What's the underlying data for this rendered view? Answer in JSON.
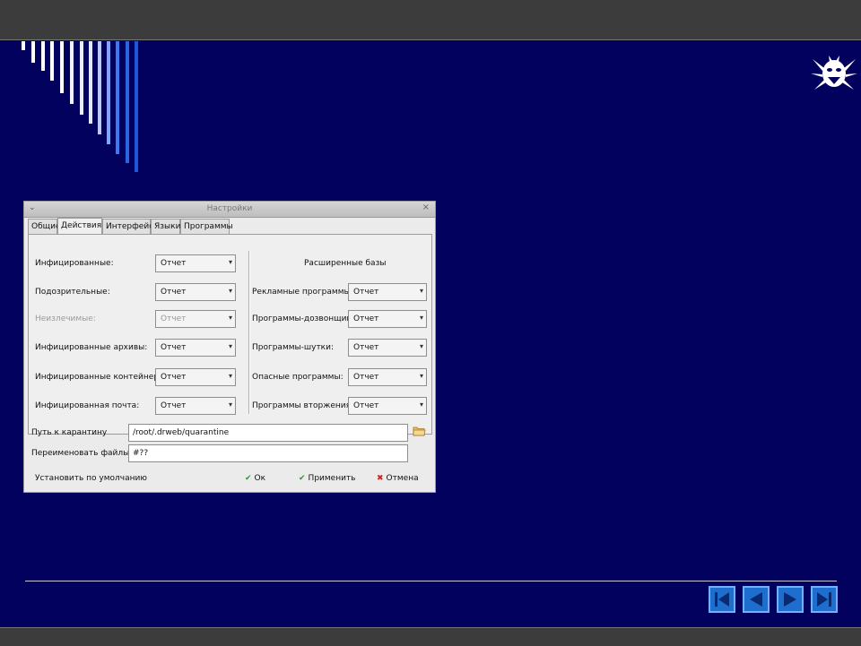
{
  "dialog": {
    "title": "Настройки",
    "menu_glyph": "⌄",
    "close_glyph": "×",
    "tabs": [
      {
        "label": "Общие"
      },
      {
        "label": "Действия"
      },
      {
        "label": "Интерфейс"
      },
      {
        "label": "Языки"
      },
      {
        "label": "Программы"
      }
    ],
    "active_tab": "Действия",
    "left_rows": [
      {
        "label": "Инфицированные:",
        "value": "Отчет",
        "disabled": false
      },
      {
        "label": "Подозрительные:",
        "value": "Отчет",
        "disabled": false
      },
      {
        "label": "Неизлечимые:",
        "value": "Отчет",
        "disabled": true
      },
      {
        "label": "Инфицированные архивы:",
        "value": "Отчет",
        "disabled": false
      },
      {
        "label": "Инфицированные контейнеры:",
        "value": "Отчет",
        "disabled": false
      },
      {
        "label": "Инфицированная почта:",
        "value": "Отчет",
        "disabled": false
      }
    ],
    "right_header": "Расширенные базы",
    "right_rows": [
      {
        "label": "Рекламные программы:",
        "value": "Отчет"
      },
      {
        "label": "Программы-дозвонщики:",
        "value": "Отчет"
      },
      {
        "label": "Программы-шутки:",
        "value": "Отчет"
      },
      {
        "label": "Опасные программы:",
        "value": "Отчет"
      },
      {
        "label": "Программы вторжения:",
        "value": "Отчет"
      }
    ],
    "combo_arrow": "▾",
    "quarantine_label": "Путь к карантину",
    "quarantine_value": "/root/.drweb/quarantine",
    "rename_label": "Переименовать файлы в",
    "rename_value": "#??",
    "defaults_label": "Установить по умолчанию",
    "ok_label": "Ок",
    "apply_label": "Применить",
    "cancel_label": "Отмена",
    "ok_icon": "✔",
    "apply_icon": "✔",
    "cancel_icon": "✖"
  },
  "colors": {
    "background": "#02025e",
    "accent": "#1e6ed0",
    "ok_green": "#2e9a2e",
    "cancel_red": "#d02020"
  },
  "icons": {
    "logo": "drweb-spider-logo",
    "folder": "folder-icon",
    "nav": [
      "first-slide-icon",
      "prev-slide-icon",
      "next-slide-icon",
      "last-slide-icon"
    ]
  }
}
